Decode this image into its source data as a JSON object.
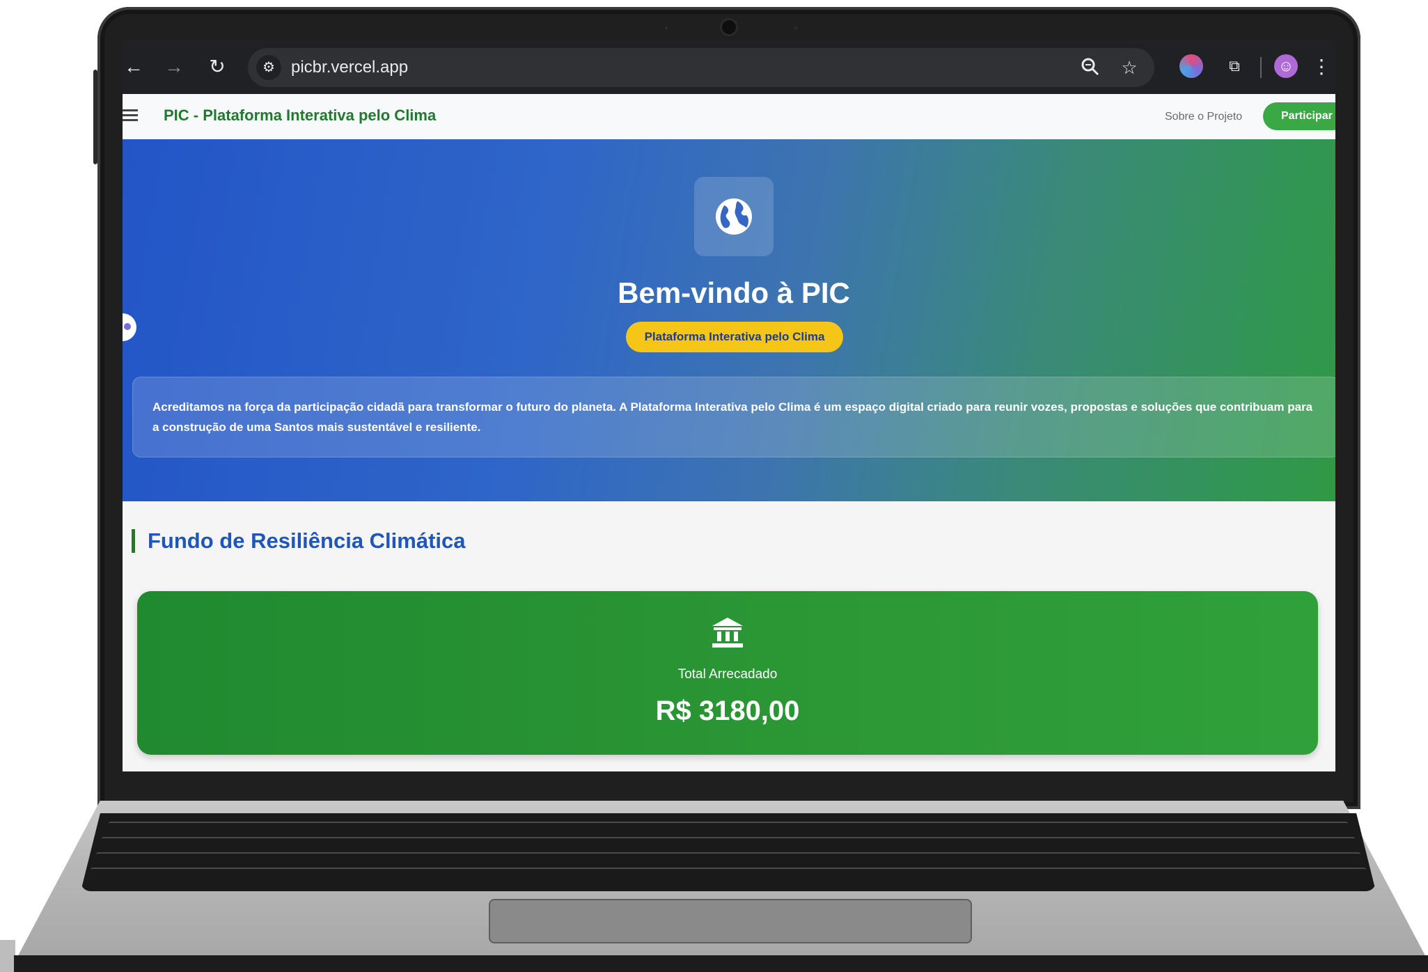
{
  "browser": {
    "url": "picbr.vercel.app",
    "icons": {
      "back": "arrow-left-icon",
      "forward": "arrow-right-icon",
      "reload": "reload-icon",
      "site_info": "tune-icon",
      "zoom": "zoom-icon",
      "bookmark": "star-icon",
      "extension": "brain-extension-icon",
      "extensions_menu": "puzzle-icon",
      "profile": "profile-avatar-icon",
      "menu": "more-vert-icon"
    }
  },
  "header": {
    "brand": "PIC - Plataforma Interativa pelo Clima",
    "nav": [
      {
        "label": "Sobre o Projeto"
      }
    ],
    "cta": "Participar",
    "menu_icon": "hamburger-icon"
  },
  "hero": {
    "icon": "globe-icon",
    "title": "Bem-vindo à PIC",
    "badge": "Plataforma Interativa pelo Clima",
    "intro": "Acreditamos na força da participação cidadã para transformar o futuro do planeta. A Plataforma Interativa pelo Clima é um espaço digital criado para reunir vozes, propostas e soluções que contribuam para a construção de uma Santos mais sustentável e resiliente."
  },
  "fund": {
    "section_title": "Fundo de Resiliência Climática",
    "icon": "bank-icon",
    "label": "Total Arrecadado",
    "value": "R$ 3180,00"
  },
  "colors": {
    "brand_green": "#1f7a2e",
    "cta_green": "#3aa845",
    "hero_blue": "#2355c7",
    "badge_yellow": "#f5c518",
    "title_blue": "#1f56b8",
    "card_green": "#2a9534"
  }
}
